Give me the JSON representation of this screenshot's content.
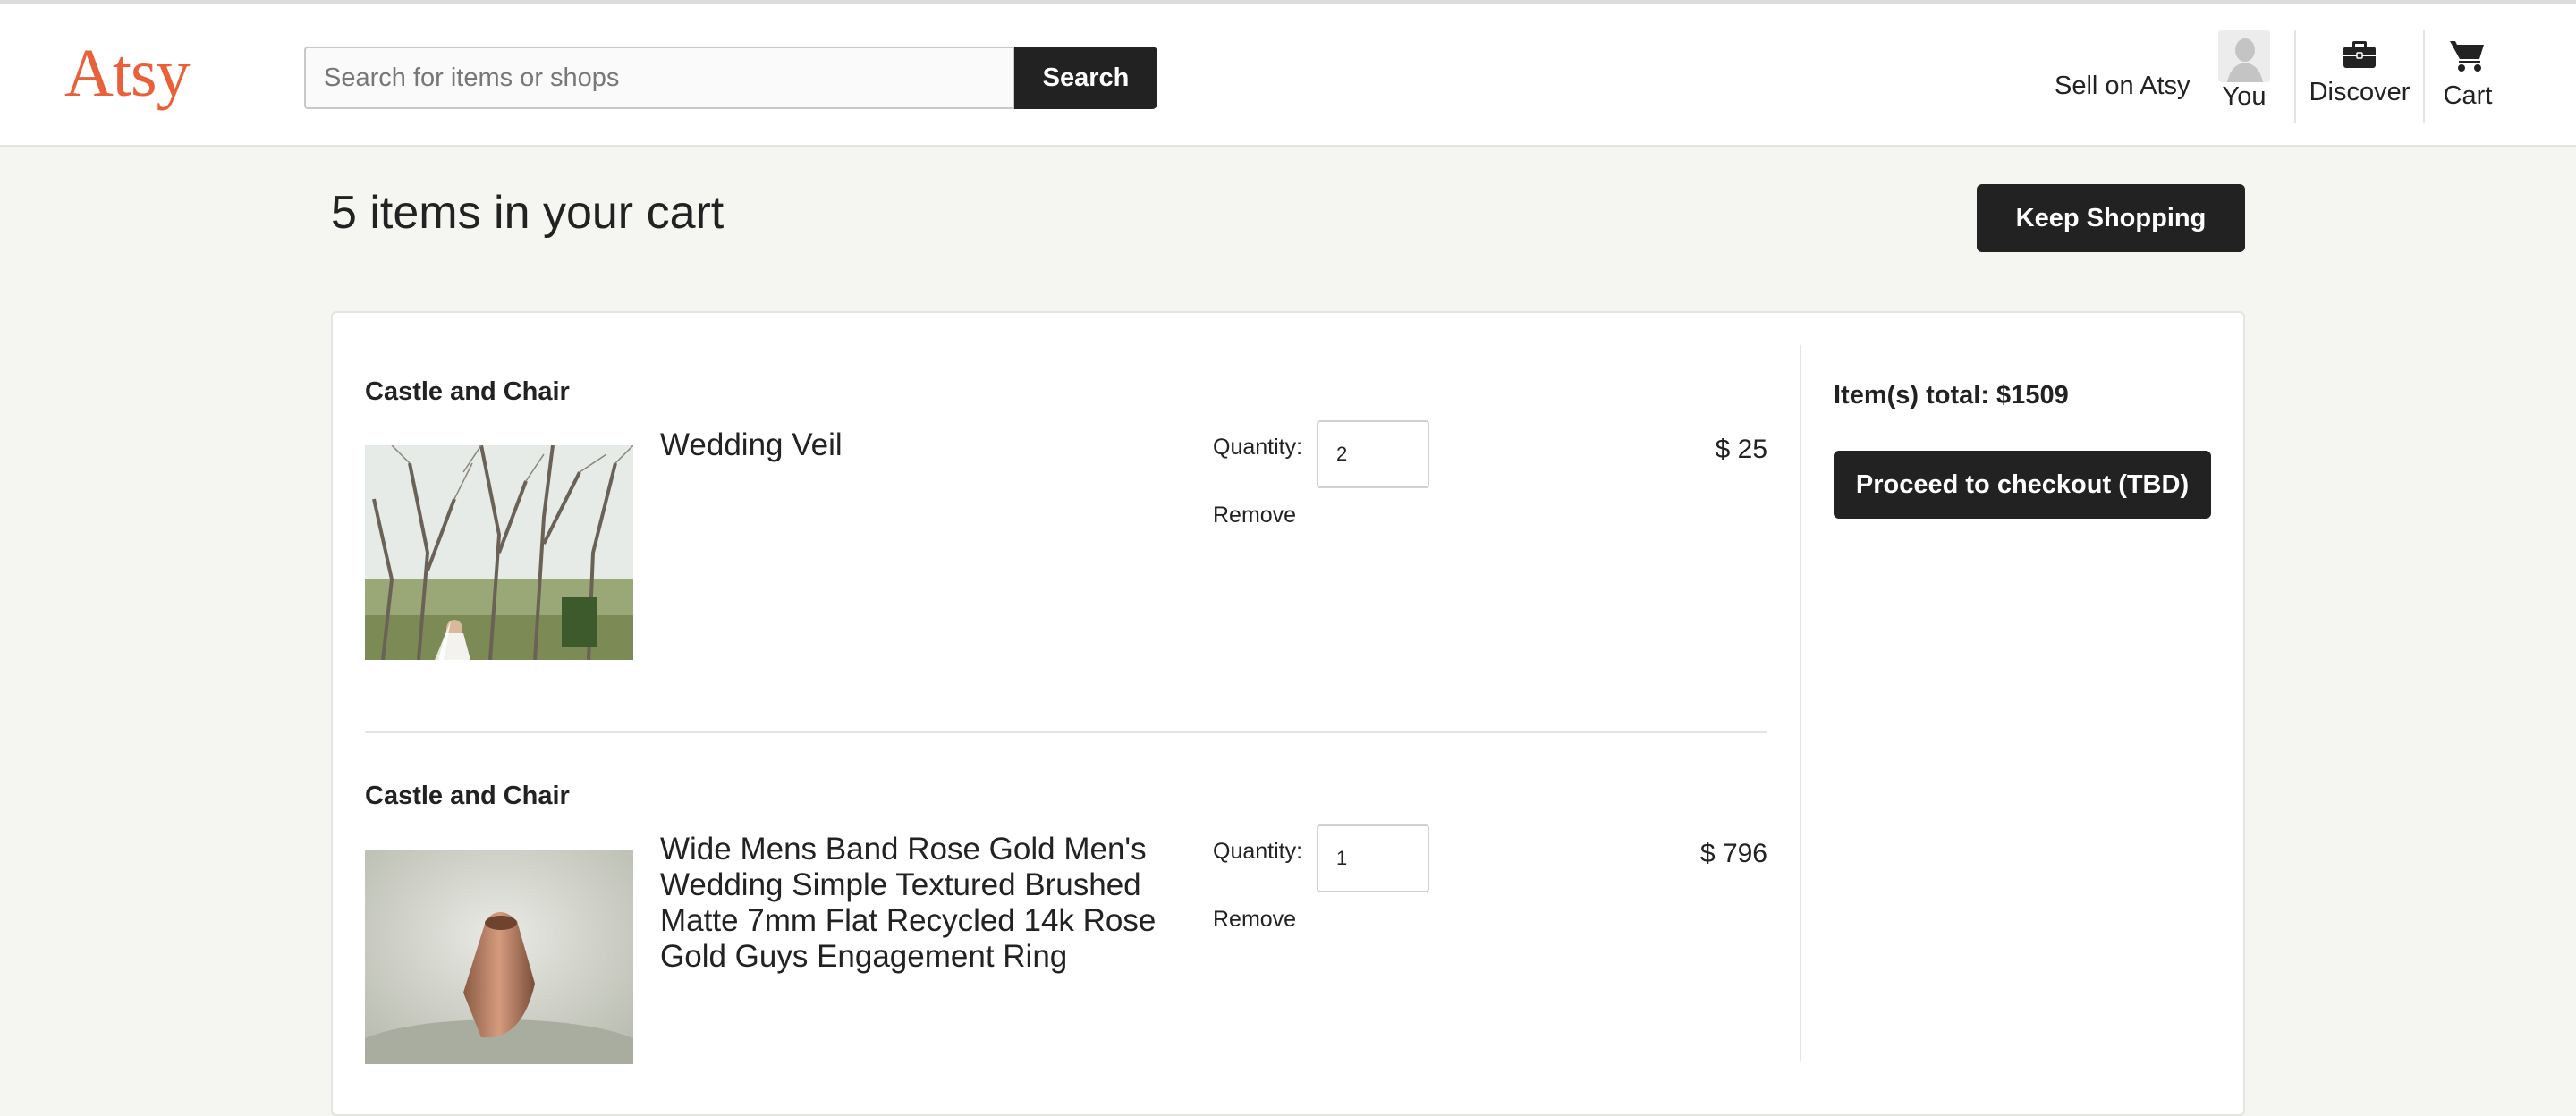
{
  "header": {
    "logo": "Atsy",
    "search_placeholder": "Search for items or shops",
    "search_button": "Search",
    "nav": {
      "sell": "Sell on Atsy",
      "you": "You",
      "discover": "Discover",
      "cart": "Cart"
    }
  },
  "main": {
    "title": "5 items in your cart",
    "keep_shopping": "Keep Shopping"
  },
  "summary": {
    "total": "Item(s) total: $1509",
    "checkout": "Proceed to checkout (TBD)"
  },
  "items": [
    {
      "shop": "Castle and Chair",
      "name": "Wedding Veil",
      "quantity_label": "Quantity:",
      "quantity": "2",
      "remove": "Remove",
      "price": "$ 25"
    },
    {
      "shop": "Castle and Chair",
      "name": "Wide Mens Band Rose Gold Men's Wedding Simple Textured Brushed Matte 7mm Flat Recycled 14k Rose Gold Guys Engagement Ring",
      "quantity_label": "Quantity:",
      "quantity": "1",
      "remove": "Remove",
      "price": "$ 796"
    }
  ],
  "icons": {
    "discover": "briefcase-icon",
    "cart": "cart-icon",
    "avatar": "user-avatar"
  },
  "colors": {
    "brand": "#e8613a",
    "button": "#222222",
    "page_bg": "#f5f5f1"
  }
}
